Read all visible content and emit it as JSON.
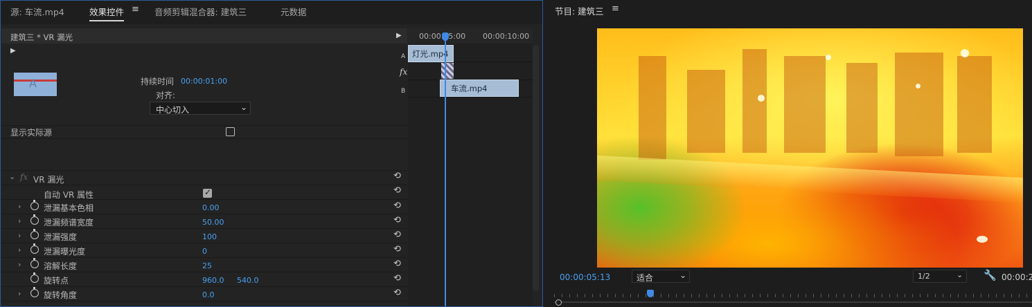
{
  "left_tabs": {
    "source": "源: 车流.mp4",
    "effect_controls": "效果控件",
    "audio_mixer": "音频剪辑混合器: 建筑三",
    "metadata": "元数据"
  },
  "menu_glyph": "≡",
  "effect_controls": {
    "clip_title": "建筑三 * VR 漏光",
    "duration_label": "持续时间",
    "duration_value": "00:00:01:00",
    "align_label": "对齐:",
    "align_value": "中心切入",
    "show_actual_source": "显示实际源",
    "show_actual_source_checked": false,
    "effect_name": "VR 漏光",
    "fx_glyph": "fx",
    "auto_vr": {
      "label": "自动 VR 属性",
      "checked": true
    },
    "properties": [
      {
        "name": "泄漏基本色相",
        "value": "0.00",
        "expandable": true
      },
      {
        "name": "泄漏频谱宽度",
        "value": "50.00",
        "expandable": true
      },
      {
        "name": "泄漏强度",
        "value": "100",
        "expandable": true
      },
      {
        "name": "泄漏曝光度",
        "value": "0",
        "expandable": true
      },
      {
        "name": "溶解长度",
        "value": "25",
        "expandable": true
      },
      {
        "name": "旋转点",
        "value": "960.0",
        "value2": "540.0",
        "expandable": false
      },
      {
        "name": "旋转角度",
        "value": "0.0",
        "expandable": true
      }
    ]
  },
  "mini_timeline": {
    "tc1": "00:00:05:00",
    "tc2": "00:00:10:00",
    "track_a": "A",
    "track_b": "B",
    "clip_a": "灯光.mp4",
    "clip_b": "车流.mp4"
  },
  "program": {
    "title": "节目: 建筑三",
    "timecode": "00:00:05:13",
    "fit": "适合",
    "resolution": "1/2",
    "timecode_end": "00:00:2"
  },
  "icons": {
    "play": "▶",
    "reset": "⟲",
    "chevron_down": "⌄",
    "expand": "›",
    "wrench": "🔧"
  },
  "colors": {
    "accent_blue": "#4aa0ef",
    "playhead": "#3f8ae6",
    "clip": "#a7bdd6"
  }
}
